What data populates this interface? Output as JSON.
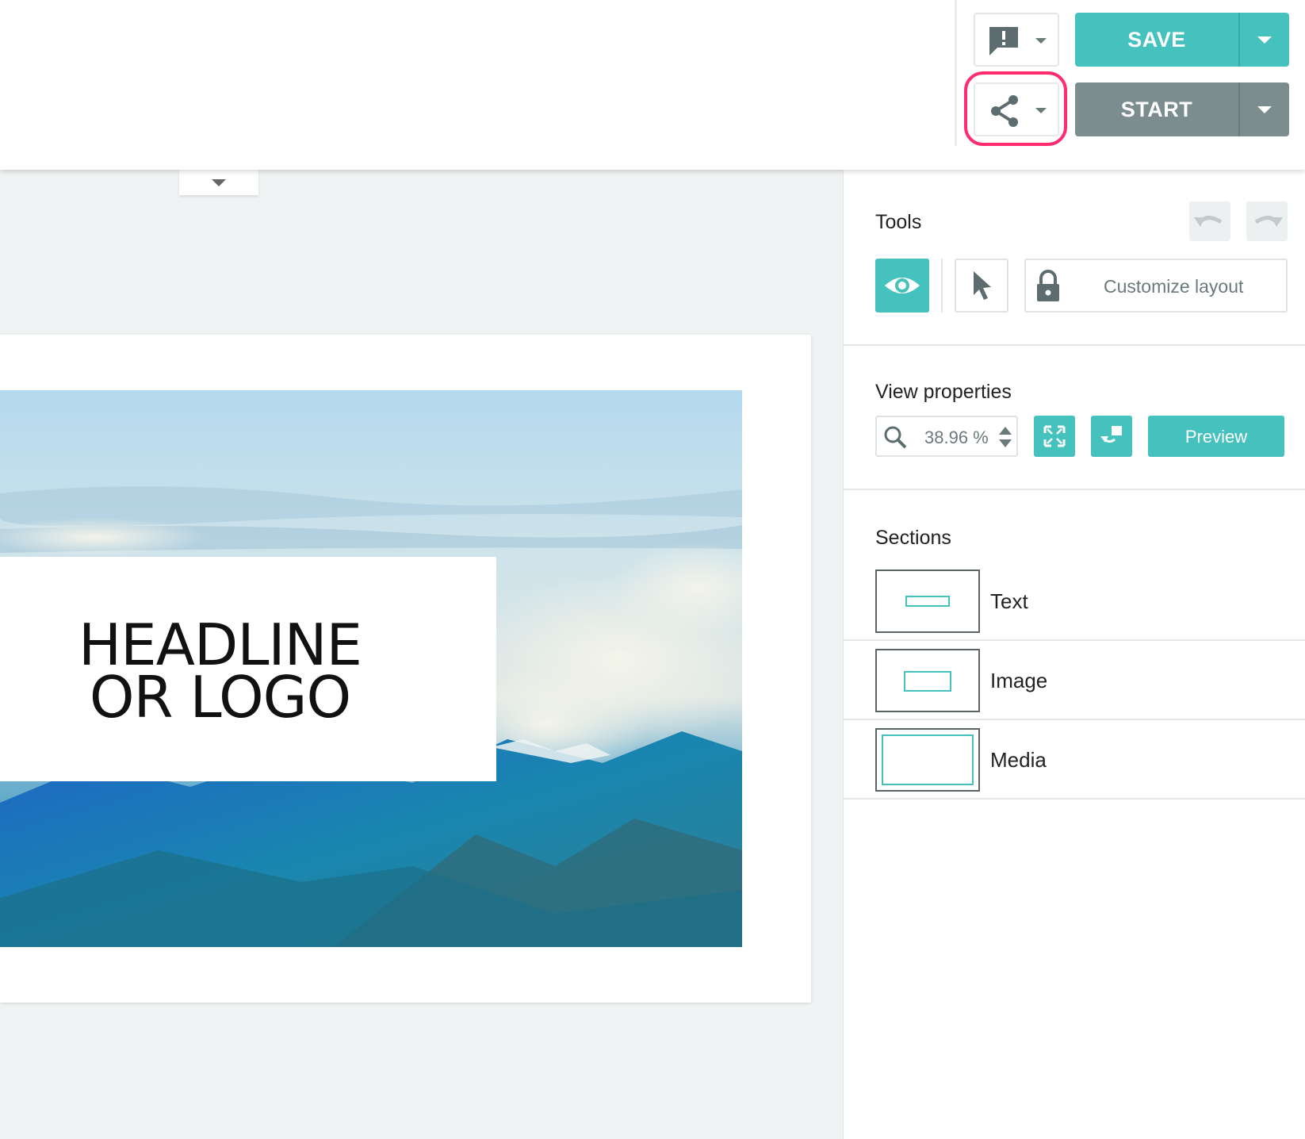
{
  "topbar": {
    "save_label": "SAVE",
    "start_label": "START",
    "colors": {
      "save": "#45c2bd",
      "start": "#7b8d8e",
      "highlight": "#ff2d6f"
    }
  },
  "slide": {
    "headline_line1": "HEADLINE",
    "headline_line2": "OR LOGO"
  },
  "tools": {
    "title": "Tools",
    "customize_label": "Customize layout"
  },
  "view_properties": {
    "title": "View properties",
    "zoom_value": "38.96 %",
    "preview_label": "Preview"
  },
  "sections": {
    "title": "Sections",
    "items": [
      {
        "label": "Text"
      },
      {
        "label": "Image"
      },
      {
        "label": "Media"
      }
    ]
  },
  "icons": [
    "feedback-icon",
    "share-icon",
    "undo-icon",
    "redo-icon",
    "eye-icon",
    "pointer-icon",
    "lock-icon",
    "search-icon",
    "fullscreen-icon",
    "fit-view-icon"
  ]
}
